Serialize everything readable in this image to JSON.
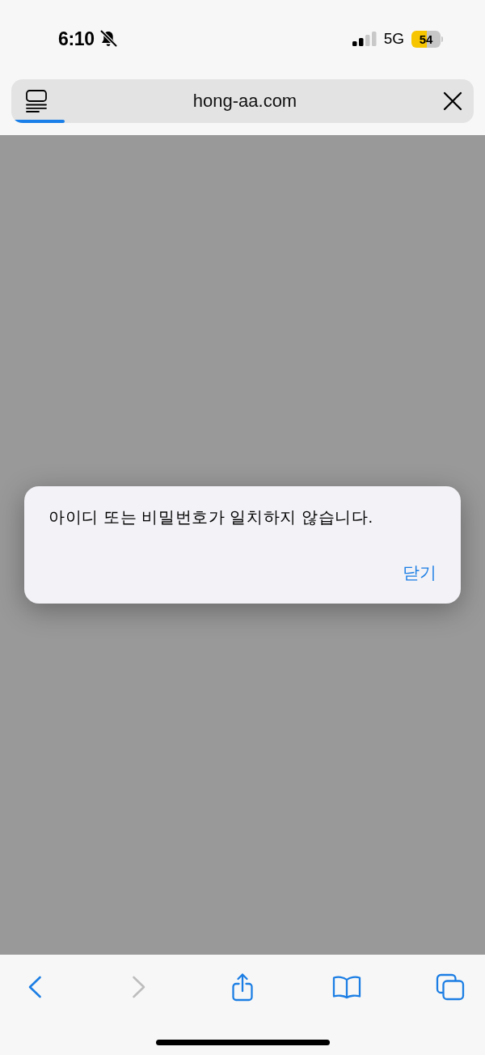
{
  "status_bar": {
    "time": "6:10",
    "silent": true,
    "network": "5G",
    "battery": {
      "text": "54",
      "low_power_mode": true
    }
  },
  "address_bar": {
    "url": "hong-aa.com",
    "load_progress": {
      "level": 0.11
    }
  },
  "alert": {
    "message": "아이디 또는 비밀번호가 일치하지 않습니다.",
    "button": "닫기"
  },
  "toolbar": {
    "items": [
      {
        "kind": "back",
        "disabled": false
      },
      {
        "kind": "forward",
        "disabled": true
      },
      {
        "kind": "share",
        "disabled": false
      },
      {
        "kind": "bookmarks",
        "disabled": false
      },
      {
        "kind": "tabs",
        "disabled": false
      }
    ]
  }
}
